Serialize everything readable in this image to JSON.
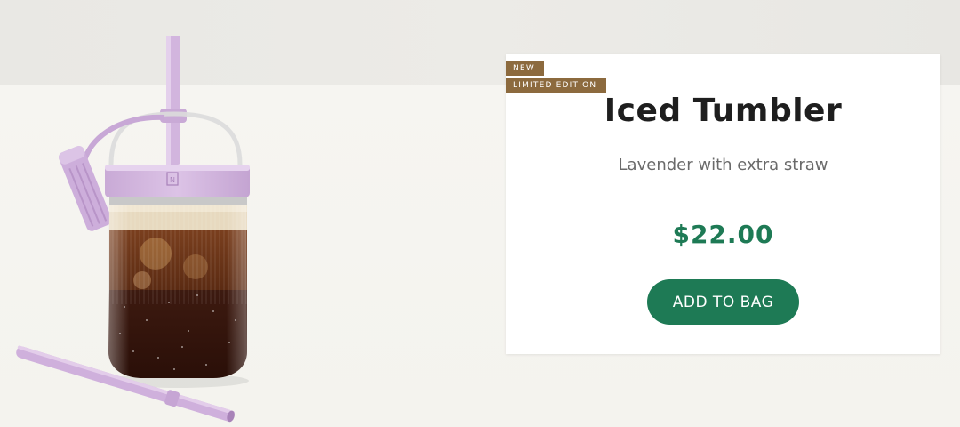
{
  "product": {
    "badges": [
      "NEW",
      "LIMITED EDITION"
    ],
    "title": "Iced Tumbler",
    "subtitle": "Lavender with extra straw",
    "price": "$22.00",
    "add_button_label": "ADD TO BAG"
  },
  "colors": {
    "accent_green": "#1e7a55",
    "badge_brown": "#8c6a3e",
    "product_lavender": "#d6b9e0"
  },
  "image": {
    "icon": "tumbler-product-image"
  }
}
